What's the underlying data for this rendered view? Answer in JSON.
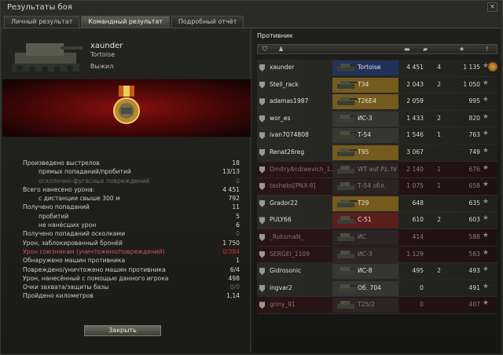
{
  "window": {
    "title": "Результаты боя",
    "close_glyph": "×"
  },
  "tabs": [
    {
      "label": "Личный результат"
    },
    {
      "label": "Командный результат"
    },
    {
      "label": "Подробный отчёт"
    }
  ],
  "player": {
    "name": "xaunder",
    "tank": "Tortoise",
    "status": "Выжил"
  },
  "stats": [
    {
      "label": "Произведено выстрелов",
      "value": "18"
    },
    {
      "label": "прямых попаданий/пробитий",
      "value": "13/13"
    },
    {
      "label": "осколочно-фугасных повреждений",
      "value": "0"
    },
    {
      "label": "Всего нанесено урона:",
      "value": "4 451"
    },
    {
      "label": "с дистанции свыше 300 м",
      "value": "792"
    },
    {
      "label": "Получено попаданий",
      "value": "11"
    },
    {
      "label": "пробитий",
      "value": "5"
    },
    {
      "label": "не нанёсших урон",
      "value": "6"
    },
    {
      "label": "Получено попаданий осколками",
      "value": "0"
    },
    {
      "label": "Урон, заблокированный бронёй",
      "value": "1 750"
    },
    {
      "label": "Урон союзникам (уничтожено/повреждений)",
      "value": "0/384"
    },
    {
      "label": "Обнаружено машин противника",
      "value": "1"
    },
    {
      "label": "Повреждено/уничтожено машин противника",
      "value": "6/4"
    },
    {
      "label": "Урон, нанесённый с помощью данного игрока",
      "value": "498"
    },
    {
      "label": "Очки захвата/защиты базы",
      "value": "0/0"
    },
    {
      "label": "Пройдено километров",
      "value": "1,14"
    }
  ],
  "close_button": "Закрыть",
  "enemy_header": "Противник",
  "column_icons": [
    "shield-icon",
    "person-icon",
    "shell-icon",
    "tank-icon",
    "xp-icon",
    "medal-icon"
  ],
  "players": [
    {
      "name": "xaunder",
      "tank": "Tortoise",
      "dmg": "4 451",
      "kills": "4",
      "xp": "1 135",
      "alive": true,
      "nation_color": "#1f3c8c",
      "ach": true
    },
    {
      "name": "Stell_rack",
      "tank": "T34",
      "dmg": "2 043",
      "kills": "2",
      "xp": "1 050",
      "alive": true,
      "nation_color": "#b8891e"
    },
    {
      "name": "adamas1987",
      "tank": "T26E4",
      "dmg": "2 059",
      "kills": "",
      "xp": "995",
      "alive": true,
      "nation_color": "#b8891e"
    },
    {
      "name": "wor_es",
      "tank": "ИС-3",
      "dmg": "1 433",
      "kills": "2",
      "xp": "820",
      "alive": true,
      "nation_color": "#444"
    },
    {
      "name": "ivan7074808",
      "tank": "Т-54",
      "dmg": "1 546",
      "kills": "1",
      "xp": "763",
      "alive": true,
      "nation_color": "#444"
    },
    {
      "name": "Renat26reg",
      "tank": "T95",
      "dmg": "3 067",
      "kills": "",
      "xp": "749",
      "alive": true,
      "nation_color": "#b8891e"
    },
    {
      "name": "DmitryAndreevich_1...",
      "tank": "WT auf Pz. IV",
      "dmg": "2 140",
      "kills": "1",
      "xp": "676",
      "alive": false,
      "nation_color": "#333"
    },
    {
      "name": "teshebs[PNX-8]",
      "tank": "Т-54 обл.",
      "dmg": "1 075",
      "kills": "1",
      "xp": "658",
      "alive": false,
      "nation_color": "#333"
    },
    {
      "name": "Grador22",
      "tank": "T29",
      "dmg": "648",
      "kills": "",
      "xp": "635",
      "alive": true,
      "nation_color": "#b8891e"
    },
    {
      "name": "PULY66",
      "tank": "С-51",
      "dmg": "610",
      "kills": "2",
      "xp": "603",
      "alive": true,
      "nation_color": "#8a1a1a"
    },
    {
      "name": "_RoksmaN_",
      "tank": "ИС",
      "dmg": "414",
      "kills": "",
      "xp": "588",
      "alive": false,
      "nation_color": "#333"
    },
    {
      "name": "SERGEI_1109",
      "tank": "ИС-3",
      "dmg": "1 129",
      "kills": "",
      "xp": "583",
      "alive": false,
      "nation_color": "#333"
    },
    {
      "name": "Gidrosonic",
      "tank": "ИС-8",
      "dmg": "495",
      "kills": "2",
      "xp": "493",
      "alive": true,
      "nation_color": "#444"
    },
    {
      "name": "ingvar2",
      "tank": "Об. 704",
      "dmg": "0",
      "kills": "",
      "xp": "491",
      "alive": true,
      "nation_color": "#444"
    },
    {
      "name": "griny_91",
      "tank": "T25/2",
      "dmg": "0",
      "kills": "",
      "xp": "407",
      "alive": false,
      "nation_color": "#333"
    }
  ]
}
